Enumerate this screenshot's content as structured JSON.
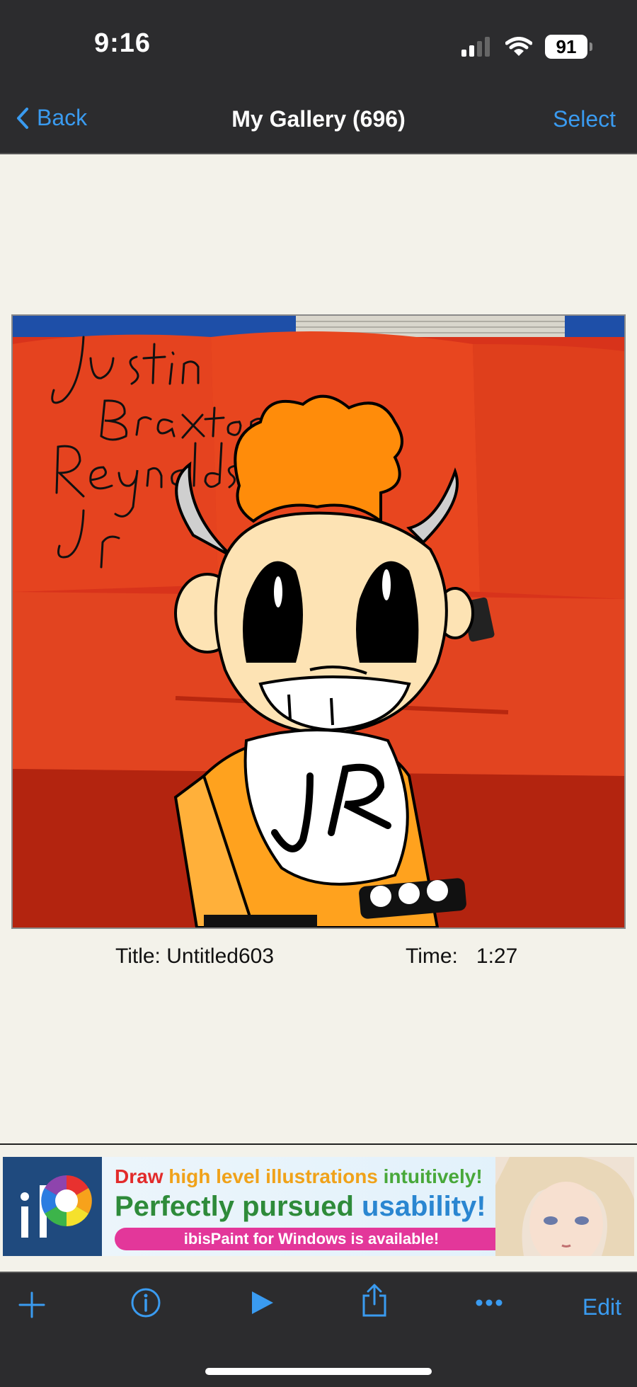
{
  "status_bar": {
    "time": "9:16",
    "battery": "91"
  },
  "nav": {
    "back_label": "Back",
    "title": "My Gallery (696)",
    "select_label": "Select"
  },
  "artwork": {
    "signature_text": "Justin Braxton Reynolds Jr",
    "shirt_text": "JR"
  },
  "meta": {
    "title_label": "Title: Untitled603",
    "time_label": "Time:",
    "time_value": "1:27"
  },
  "ad": {
    "line1_a": "Draw",
    "line1_b": "high level illustrations",
    "line1_c": "intuitively!",
    "line2_a": "Perfectly pursued",
    "line2_b": "usability!",
    "pill": "ibisPaint for Windows is available!"
  },
  "toolbar": {
    "add_icon": "plus-icon",
    "info_icon": "info-icon",
    "play_icon": "play-icon",
    "share_icon": "share-icon",
    "more_icon": "ellipsis-icon",
    "edit_label": "Edit"
  },
  "colors": {
    "accent": "#3a9bf0",
    "bar_bg": "#2c2c2e",
    "page_bg": "#f3f2ea",
    "couch": "#e0381e"
  }
}
